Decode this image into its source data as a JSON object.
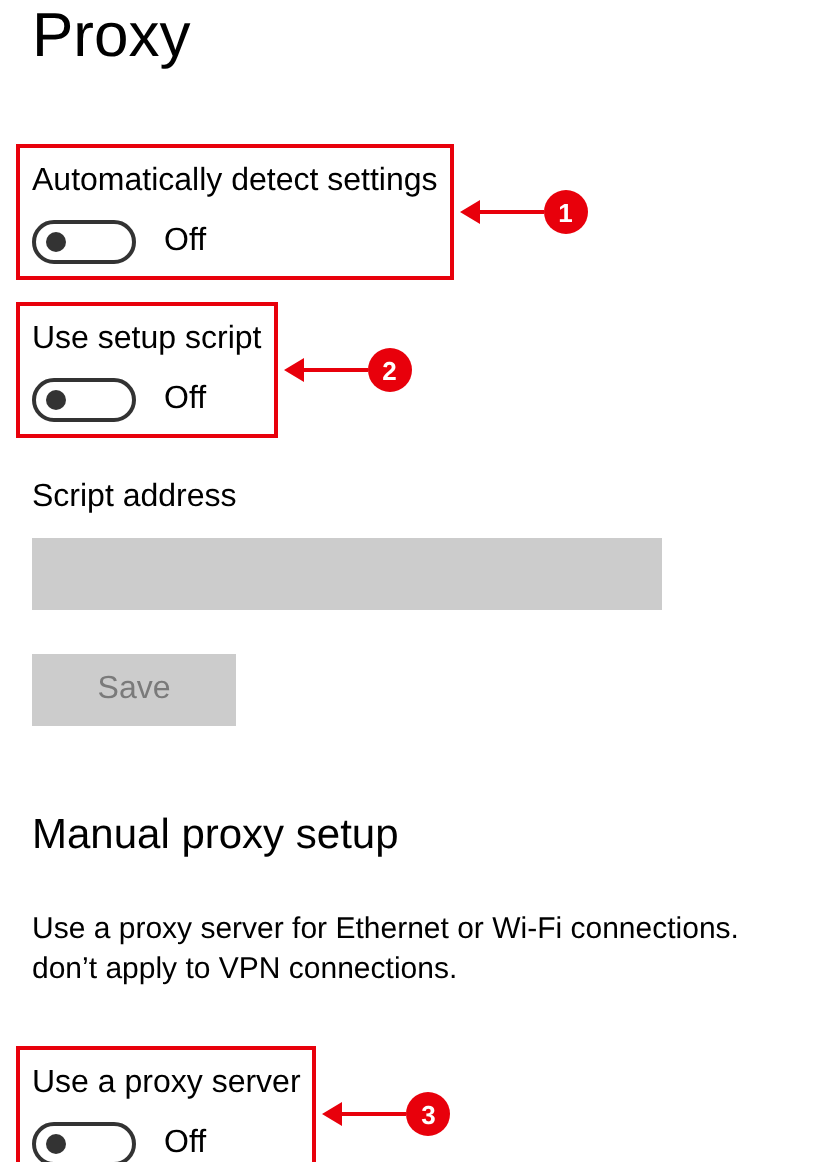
{
  "page_title": "Proxy",
  "automatic_section": {
    "toggles": [
      {
        "label": "Automatically detect settings",
        "state_text": "Off",
        "on": false,
        "callout": "1"
      },
      {
        "label": "Use setup script",
        "state_text": "Off",
        "on": false,
        "callout": "2"
      }
    ],
    "script_address": {
      "label": "Script address",
      "disabled": true
    },
    "save_button": {
      "label": "Save",
      "disabled": true
    }
  },
  "manual_section": {
    "heading": "Manual proxy setup",
    "description": [
      "Use a proxy server for Ethernet or Wi-Fi connections.",
      "don’t apply to VPN connections."
    ],
    "toggles": [
      {
        "label": "Use a proxy server",
        "state_text": "Off",
        "on": false,
        "callout": "3"
      }
    ]
  }
}
